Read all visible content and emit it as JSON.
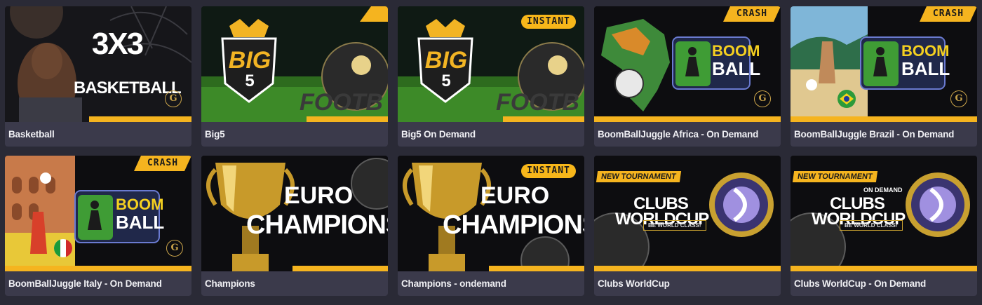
{
  "games": [
    {
      "label": "Basketball",
      "art_title": "3X3",
      "art_subtitle": "BASKETBALL",
      "badge": ""
    },
    {
      "label": "Big5",
      "art_title": "BIG",
      "art_number": "5",
      "art_word": "FOOTB",
      "badge": ""
    },
    {
      "label": "Big5 On Demand",
      "art_title": "BIG",
      "art_number": "5",
      "art_word": "FOOTB",
      "badge": "INSTANT"
    },
    {
      "label": "BoomBallJuggle Africa - On Demand",
      "art_line1": "BOOM",
      "art_line2": "BALL",
      "badge": "CRASH"
    },
    {
      "label": "BoomBallJuggle Brazil - On Demand",
      "art_line1": "BOOM",
      "art_line2": "BALL",
      "badge": "CRASH"
    },
    {
      "label": "BoomBallJuggle Italy - On Demand",
      "art_line1": "BOOM",
      "art_line2": "BALL",
      "badge": "CRASH"
    },
    {
      "label": "Champions",
      "art_line1": "EURO",
      "art_line2": "CHAMPIONS",
      "badge": ""
    },
    {
      "label": "Champions - ondemand",
      "art_line1": "EURO",
      "art_line2": "CHAMPIONS",
      "badge": "INSTANT"
    },
    {
      "label": "Clubs WorldCup",
      "art_tag": "NEW TOURNAMENT",
      "art_title": "CLUBS WORLDCUP",
      "art_slogan": "BE WORLD CLASS!",
      "art_extra": "",
      "badge": ""
    },
    {
      "label": "Clubs WorldCup - On Demand",
      "art_tag": "NEW TOURNAMENT",
      "art_title": "CLUBS WORLDCUP",
      "art_slogan": "BE WORLD CLASS!",
      "art_extra": "ON DEMAND",
      "badge": ""
    }
  ],
  "logo_letter": "G",
  "colors": {
    "accent": "#f5b41f",
    "card_bg": "#3b3a4b",
    "page_bg": "#2a2a36",
    "boom_green": "#3f9c35"
  }
}
